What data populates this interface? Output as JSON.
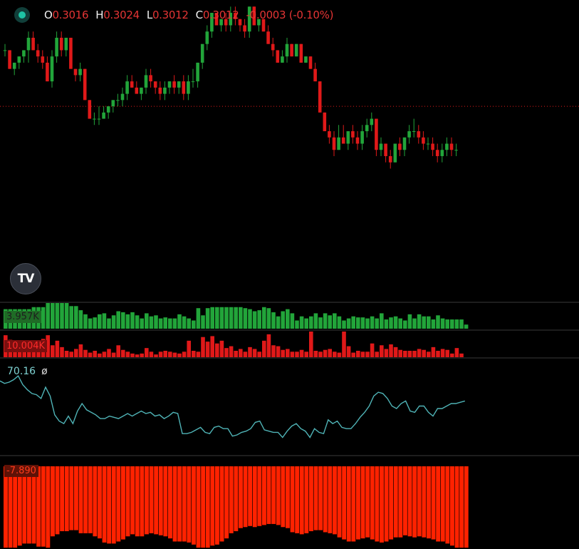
{
  "header": {
    "o_label": "O",
    "o_value": "0.3016",
    "h_label": "H",
    "h_value": "0.3024",
    "l_label": "L",
    "l_value": "0.3012",
    "c_label": "C",
    "c_value": "0.3012",
    "change": "-0.0003 (-0.10%)"
  },
  "logo_text": "TV",
  "panels": {
    "buy_volume_label": "3.957K",
    "sell_volume_label": "10.004K",
    "line_value_label": "70.16",
    "line_symbol": "ø",
    "osc_label": "-7.890"
  },
  "colors": {
    "up": "#22a53a",
    "down": "#e01919",
    "line": "#4fb3b6",
    "osc": "#ff2200",
    "ref": "#e01919"
  },
  "chart_data": [
    {
      "type": "candlestick",
      "y_unit": "price",
      "ylim": [
        0.2985,
        0.3027
      ],
      "reference_price": 0.3012,
      "candles": [
        [
          0.3021,
          0.3022,
          0.302,
          0.3021
        ],
        [
          0.3021,
          0.3021,
          0.3018,
          0.3018
        ],
        [
          0.3018,
          0.3019,
          0.3017,
          0.3019
        ],
        [
          0.3019,
          0.302,
          0.3018,
          0.302
        ],
        [
          0.302,
          0.3021,
          0.3019,
          0.3021
        ],
        [
          0.3021,
          0.3024,
          0.3019,
          0.3023
        ],
        [
          0.3023,
          0.3024,
          0.3021,
          0.3021
        ],
        [
          0.3021,
          0.3022,
          0.3019,
          0.302
        ],
        [
          0.302,
          0.3021,
          0.3018,
          0.3019
        ],
        [
          0.3019,
          0.302,
          0.3016,
          0.3016
        ],
        [
          0.3016,
          0.3021,
          0.3015,
          0.302
        ],
        [
          0.302,
          0.3024,
          0.3019,
          0.3023
        ],
        [
          0.3023,
          0.3024,
          0.302,
          0.3021
        ],
        [
          0.3021,
          0.3023,
          0.302,
          0.3023
        ],
        [
          0.3023,
          0.3023,
          0.3019,
          0.3018
        ],
        [
          0.3018,
          0.3018,
          0.3016,
          0.3017
        ],
        [
          0.3017,
          0.3019,
          0.3016,
          0.3018
        ],
        [
          0.3018,
          0.3018,
          0.3013,
          0.3013
        ],
        [
          0.3013,
          0.3013,
          0.301,
          0.301
        ],
        [
          0.301,
          0.3011,
          0.3009,
          0.301
        ],
        [
          0.301,
          0.3012,
          0.3009,
          0.301
        ],
        [
          0.301,
          0.3012,
          0.301,
          0.3011
        ],
        [
          0.3011,
          0.3012,
          0.301,
          0.3012
        ],
        [
          0.3012,
          0.3013,
          0.3011,
          0.3013
        ],
        [
          0.3013,
          0.3014,
          0.3012,
          0.3013
        ],
        [
          0.3013,
          0.3015,
          0.3012,
          0.3014
        ],
        [
          0.3014,
          0.3017,
          0.3013,
          0.3016
        ],
        [
          0.3016,
          0.3017,
          0.3015,
          0.3015
        ],
        [
          0.3015,
          0.3016,
          0.3014,
          0.3014
        ],
        [
          0.3014,
          0.3015,
          0.3013,
          0.3015
        ],
        [
          0.3015,
          0.3018,
          0.3014,
          0.3017
        ],
        [
          0.3017,
          0.3018,
          0.3015,
          0.3016
        ],
        [
          0.3016,
          0.3016,
          0.3014,
          0.3015
        ],
        [
          0.3015,
          0.3016,
          0.3013,
          0.3014
        ],
        [
          0.3014,
          0.3016,
          0.3013,
          0.3015
        ],
        [
          0.3015,
          0.3016,
          0.3014,
          0.3016
        ],
        [
          0.3016,
          0.3017,
          0.3014,
          0.3015
        ],
        [
          0.3015,
          0.3016,
          0.3014,
          0.3016
        ],
        [
          0.3016,
          0.3017,
          0.3013,
          0.3014
        ],
        [
          0.3014,
          0.3017,
          0.3013,
          0.3016
        ],
        [
          0.3016,
          0.3018,
          0.3015,
          0.3016
        ],
        [
          0.3016,
          0.3019,
          0.3015,
          0.3019
        ],
        [
          0.3019,
          0.3021,
          0.3018,
          0.3022
        ],
        [
          0.3022,
          0.3025,
          0.3021,
          0.3024
        ],
        [
          0.3024,
          0.3027,
          0.3023,
          0.3027
        ],
        [
          0.3027,
          0.3027,
          0.3025,
          0.3025
        ],
        [
          0.3025,
          0.3026,
          0.3024,
          0.3026
        ],
        [
          0.3026,
          0.3027,
          0.3024,
          0.3025
        ],
        [
          0.3025,
          0.3028,
          0.3024,
          0.3027
        ],
        [
          0.3027,
          0.3028,
          0.3025,
          0.3026
        ],
        [
          0.3026,
          0.3026,
          0.3024,
          0.3025
        ],
        [
          0.3025,
          0.3026,
          0.3023,
          0.3024
        ],
        [
          0.3024,
          0.3028,
          0.3023,
          0.3028
        ],
        [
          0.3028,
          0.3028,
          0.3025,
          0.3025
        ],
        [
          0.3025,
          0.3026,
          0.3024,
          0.3026
        ],
        [
          0.3026,
          0.3026,
          0.3024,
          0.3024
        ],
        [
          0.3024,
          0.3025,
          0.3022,
          0.3022
        ],
        [
          0.3022,
          0.3023,
          0.302,
          0.3021
        ],
        [
          0.3021,
          0.3021,
          0.3019,
          0.3019
        ],
        [
          0.3019,
          0.3021,
          0.3019,
          0.302
        ],
        [
          0.302,
          0.3023,
          0.3019,
          0.3022
        ],
        [
          0.3022,
          0.3022,
          0.302,
          0.302
        ],
        [
          0.302,
          0.3022,
          0.302,
          0.3022
        ],
        [
          0.3022,
          0.3022,
          0.3019,
          0.3019
        ],
        [
          0.3019,
          0.302,
          0.3019,
          0.302
        ],
        [
          0.302,
          0.302,
          0.3018,
          0.3018
        ],
        [
          0.3018,
          0.3019,
          0.3016,
          0.3016
        ],
        [
          0.3016,
          0.3016,
          0.3012,
          0.3011
        ],
        [
          0.3011,
          0.3011,
          0.3008,
          0.3008
        ],
        [
          0.3008,
          0.3009,
          0.3006,
          0.3007
        ],
        [
          0.3007,
          0.3008,
          0.3004,
          0.3005
        ],
        [
          0.3005,
          0.3009,
          0.3005,
          0.3007
        ],
        [
          0.3007,
          0.3009,
          0.3006,
          0.3006
        ],
        [
          0.3006,
          0.3008,
          0.3005,
          0.3008
        ],
        [
          0.3008,
          0.3009,
          0.3006,
          0.3007
        ],
        [
          0.3007,
          0.3008,
          0.3005,
          0.3006
        ],
        [
          0.3006,
          0.3009,
          0.3005,
          0.3008
        ],
        [
          0.3008,
          0.301,
          0.3007,
          0.3009
        ],
        [
          0.3009,
          0.3011,
          0.3008,
          0.301
        ],
        [
          0.301,
          0.301,
          0.3004,
          0.3005
        ],
        [
          0.3005,
          0.3007,
          0.3004,
          0.3006
        ],
        [
          0.3006,
          0.3006,
          0.3003,
          0.3004
        ],
        [
          0.3004,
          0.3005,
          0.3002,
          0.3003
        ],
        [
          0.3003,
          0.3006,
          0.3003,
          0.3006
        ],
        [
          0.3006,
          0.3007,
          0.3004,
          0.3005
        ],
        [
          0.3005,
          0.3007,
          0.3004,
          0.3007
        ],
        [
          0.3007,
          0.3009,
          0.3006,
          0.3008
        ],
        [
          0.3008,
          0.301,
          0.3007,
          0.3008
        ],
        [
          0.3008,
          0.3009,
          0.3006,
          0.3007
        ],
        [
          0.3007,
          0.3008,
          0.3005,
          0.3006
        ],
        [
          0.3006,
          0.3007,
          0.3005,
          0.3006
        ],
        [
          0.3006,
          0.3007,
          0.3004,
          0.3005
        ],
        [
          0.3005,
          0.3006,
          0.3003,
          0.3004
        ],
        [
          0.3004,
          0.3006,
          0.3003,
          0.3005
        ],
        [
          0.3005,
          0.3007,
          0.3004,
          0.3006
        ],
        [
          0.3006,
          0.3007,
          0.3004,
          0.3005
        ],
        [
          0.3005,
          0.3006,
          0.3004,
          0.3005
        ]
      ]
    },
    {
      "type": "bar",
      "series_color": "up",
      "values": [
        19,
        19,
        19,
        19,
        19,
        19,
        21,
        21,
        21,
        25,
        25,
        25,
        25,
        25,
        22,
        22,
        18,
        14,
        10,
        11,
        14,
        15,
        10,
        13,
        17,
        16,
        14,
        16,
        13,
        10,
        15,
        12,
        13,
        10,
        11,
        10,
        10,
        14,
        12,
        10,
        8,
        20,
        13,
        20,
        21,
        21,
        21,
        21,
        21,
        21,
        21,
        20,
        19,
        17,
        18,
        21,
        20,
        16,
        12,
        17,
        19,
        15,
        8,
        12,
        10,
        12,
        15,
        11,
        15,
        13,
        15,
        12,
        8,
        10,
        12,
        11,
        11,
        10,
        12,
        10,
        15,
        9,
        11,
        12,
        10,
        8,
        14,
        10,
        14,
        12,
        12,
        9,
        13,
        10,
        9,
        9,
        9,
        9,
        4
      ]
    },
    {
      "type": "bar",
      "series_color": "down",
      "values": [
        24,
        19,
        15,
        9,
        7,
        6,
        10,
        14,
        20,
        24,
        13,
        18,
        11,
        7,
        6,
        9,
        14,
        8,
        5,
        7,
        4,
        6,
        9,
        5,
        13,
        8,
        6,
        4,
        3,
        4,
        10,
        6,
        3,
        6,
        7,
        6,
        5,
        4,
        6,
        18,
        7,
        6,
        22,
        17,
        23,
        15,
        18,
        10,
        12,
        7,
        9,
        6,
        11,
        9,
        6,
        18,
        25,
        13,
        12,
        8,
        9,
        6,
        6,
        8,
        6,
        28,
        7,
        6,
        8,
        9,
        6,
        5,
        28,
        12,
        5,
        7,
        6,
        6,
        15,
        6,
        13,
        9,
        14,
        11,
        8,
        7,
        7,
        7,
        9,
        8,
        6,
        11,
        7,
        9,
        8,
        4,
        10,
        4
      ]
    },
    {
      "type": "line",
      "ylim": [
        0,
        100
      ],
      "values": [
        72,
        70,
        71,
        73,
        76,
        69,
        65,
        62,
        61,
        58,
        67,
        60,
        45,
        40,
        38,
        44,
        38,
        48,
        54,
        49,
        47,
        45,
        42,
        42,
        44,
        43,
        42,
        44,
        46,
        44,
        46,
        48,
        46,
        47,
        44,
        45,
        42,
        44,
        47,
        46,
        30,
        30,
        31,
        33,
        35,
        31,
        30,
        35,
        36,
        34,
        34,
        28,
        29,
        31,
        32,
        34,
        39,
        40,
        33,
        32,
        31,
        31,
        27,
        32,
        36,
        38,
        34,
        32,
        27,
        34,
        31,
        30,
        41,
        38,
        40,
        35,
        34,
        34,
        38,
        43,
        47,
        52,
        60,
        63,
        62,
        58,
        52,
        50,
        54,
        56,
        48,
        47,
        52,
        52,
        47,
        44,
        50,
        50,
        52,
        54,
        54,
        55,
        56
      ]
    },
    {
      "type": "bar",
      "series_color": "osc",
      "ylim": [
        -7.89,
        0
      ],
      "values": [
        -7.9,
        -7.9,
        -7.9,
        -7.7,
        -7.5,
        -7.5,
        -7.5,
        -7.8,
        -7.8,
        -7.9,
        -6.8,
        -6.6,
        -6.3,
        -6.3,
        -6.2,
        -6.2,
        -6.5,
        -6.5,
        -6.5,
        -6.8,
        -7.0,
        -7.4,
        -7.5,
        -7.5,
        -7.3,
        -7.1,
        -6.8,
        -6.6,
        -6.8,
        -6.8,
        -6.6,
        -6.5,
        -6.6,
        -6.7,
        -6.8,
        -7.0,
        -7.3,
        -7.3,
        -7.3,
        -7.4,
        -7.6,
        -7.9,
        -7.9,
        -7.9,
        -7.7,
        -7.6,
        -7.3,
        -7.0,
        -6.5,
        -6.3,
        -6.0,
        -5.9,
        -5.8,
        -5.9,
        -5.8,
        -5.7,
        -5.6,
        -5.6,
        -5.7,
        -5.9,
        -6.0,
        -6.4,
        -6.5,
        -6.6,
        -6.5,
        -6.3,
        -6.2,
        -6.2,
        -6.4,
        -6.5,
        -6.6,
        -6.9,
        -7.1,
        -7.3,
        -7.3,
        -7.1,
        -7.0,
        -6.9,
        -7.1,
        -7.3,
        -7.4,
        -7.3,
        -7.1,
        -6.9,
        -6.9,
        -6.7,
        -6.8,
        -6.9,
        -6.8,
        -6.9,
        -7.0,
        -7.1,
        -7.3,
        -7.3,
        -7.5,
        -7.7,
        -7.9,
        -7.9,
        -7.9
      ]
    }
  ]
}
